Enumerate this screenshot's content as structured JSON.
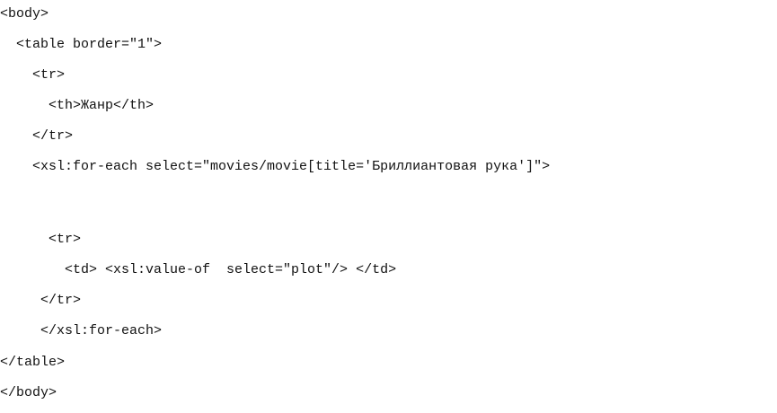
{
  "document": {
    "lines": [
      "<body>",
      "  <table border=\"1\">",
      "    <tr>",
      "      <th>Жанр</th>",
      "    </tr>",
      "    <xsl:for-each select=\"movies/movie[title='Бриллиантовая рука']\">",
      "      <tr>",
      "        <td> <xsl:value-of  select=\"plot\"/> </td>",
      "     </tr>",
      "     </xsl:for-each>",
      "</table>",
      "</body>"
    ]
  }
}
